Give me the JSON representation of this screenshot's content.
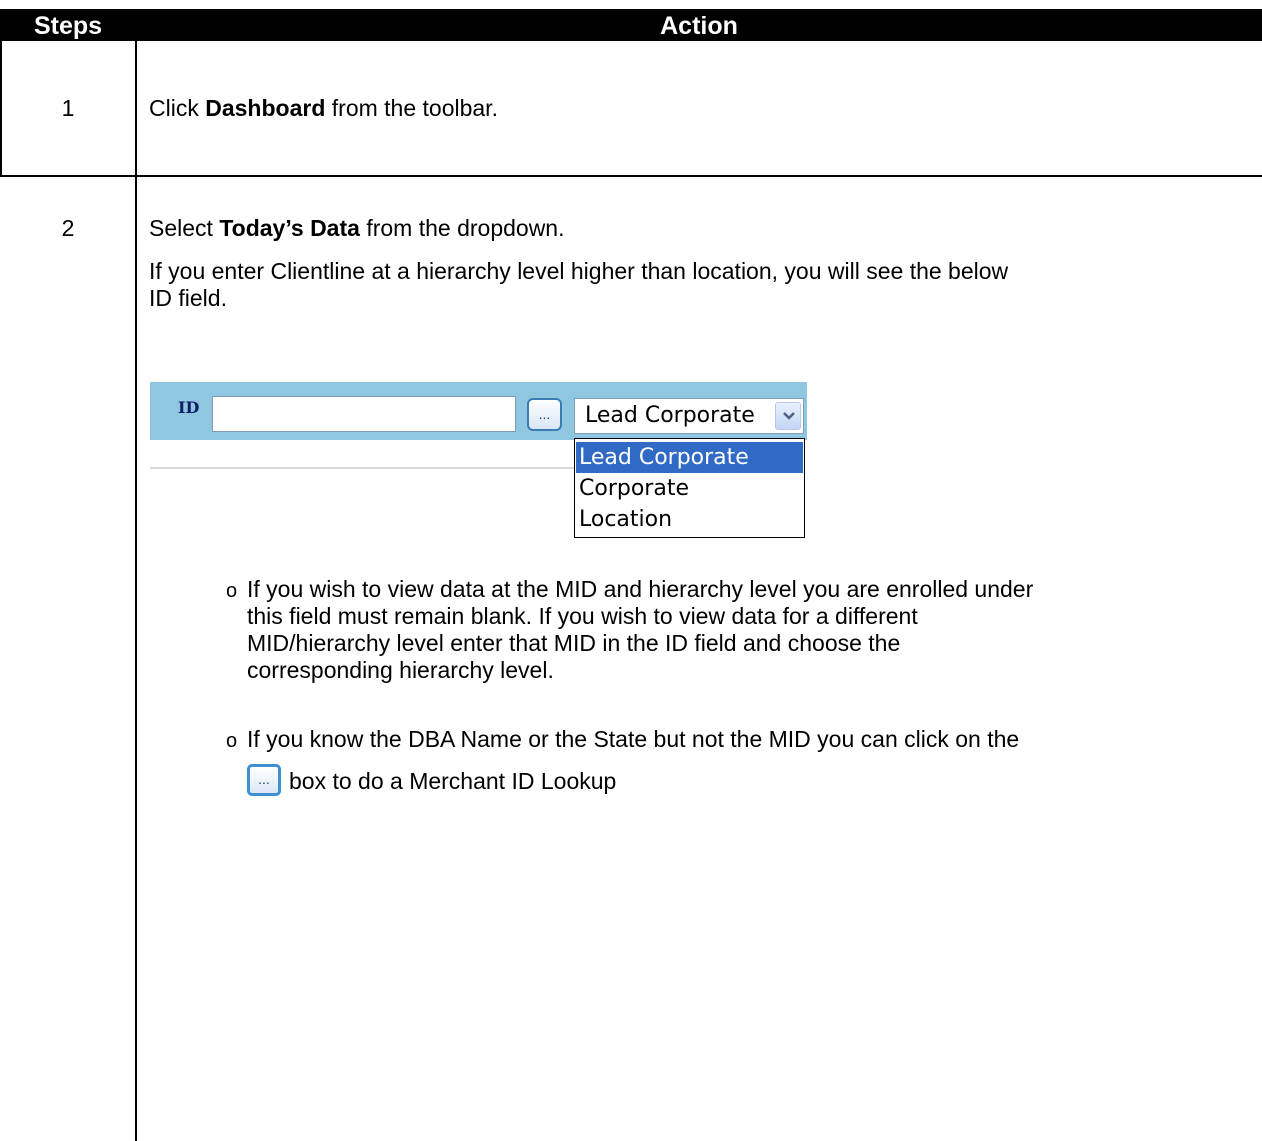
{
  "header": {
    "steps": "Steps",
    "action": "Action"
  },
  "step1": {
    "number": "1",
    "pre": "Click ",
    "bold": "Dashboard",
    "post": " from the toolbar."
  },
  "step2": {
    "number": "2",
    "pre": "Select ",
    "bold": "Today’s Data",
    "post": " from the dropdown.",
    "para_line1": "If you enter Clientline at a hierarchy level higher than location, you will see the below",
    "para_line2": "ID field.",
    "screenshot": {
      "id_label": "ID",
      "id_value": "",
      "browse_label": "...",
      "select_value": "Lead Corporate",
      "options": [
        "Lead Corporate",
        "Corporate",
        "Location"
      ],
      "selected_index": 0
    },
    "bullet_symbol": "o",
    "bullet1_lines": [
      "If you wish to view data at the MID and hierarchy level you are enrolled under",
      "this field must remain blank.  If you wish to view data for a different",
      "MID/hierarchy level enter that MID in the ID field and choose the",
      "corresponding hierarchy level."
    ],
    "bullet2_line1": "If you know the DBA Name or the State but not the MID you can click on the",
    "bullet2_line2": "box to do a Merchant ID Lookup",
    "inline_browse_label": "..."
  }
}
